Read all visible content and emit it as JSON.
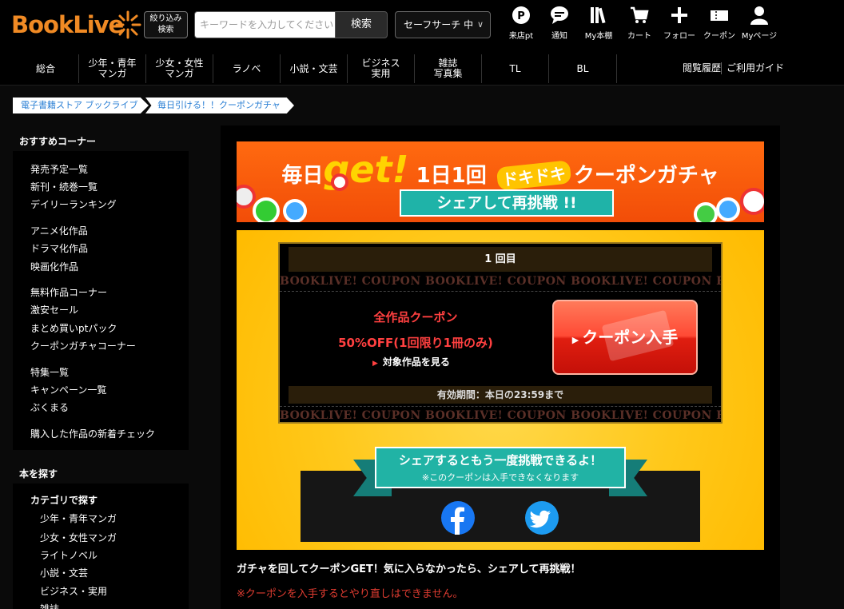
{
  "header": {
    "logo": "BookLive",
    "filter_label": "絞り込み\n検索",
    "search_placeholder": "キーワードを入力してください",
    "search_button": "検索",
    "safe_search": "セーフサーチ 中",
    "icons": [
      {
        "icon": "point-icon",
        "label": "来店pt"
      },
      {
        "icon": "bell-chat-icon",
        "label": "通知"
      },
      {
        "icon": "bookshelf-icon",
        "label": "My本棚"
      },
      {
        "icon": "cart-icon",
        "label": "カート"
      },
      {
        "icon": "plus-icon",
        "label": "フォロー"
      },
      {
        "icon": "coupon-icon",
        "label": "クーポン"
      },
      {
        "icon": "user-icon",
        "label": "Myページ"
      }
    ]
  },
  "nav": {
    "items": [
      "総合",
      "少年・青年\nマンガ",
      "少女・女性\nマンガ",
      "ラノベ",
      "小説・文芸",
      "ビジネス\n実用",
      "雑誌\n写真集",
      "TL",
      "BL"
    ],
    "history": "閲覧履歴",
    "guide": "ご利用ガイド"
  },
  "breadcrumb": [
    "電子書籍ストア ブックライブ",
    "毎日引ける！！クーポンガチャ"
  ],
  "sidebar": {
    "recommend_title": "おすすめコーナー",
    "group1": [
      "発売予定一覧",
      "新刊・続巻一覧",
      "デイリーランキング"
    ],
    "group2": [
      "アニメ化作品",
      "ドラマ化作品",
      "映画化作品"
    ],
    "group3": [
      "無料作品コーナー",
      "激安セール",
      "まとめ買いptパック",
      "クーポンガチャコーナー"
    ],
    "group4": [
      "特集一覧",
      "キャンペーン一覧",
      "ぶくまる"
    ],
    "group5": [
      "購入した作品の新着チェック"
    ],
    "find_title": "本を探す",
    "category_title": "カテゴリで探す",
    "categories": [
      "少年・青年マンガ",
      "少女・女性マンガ",
      "ライトノベル",
      "小説・文芸",
      "ビジネス・実用",
      "雑誌"
    ]
  },
  "banner": {
    "title_prefix": "毎日",
    "title_get": "get!",
    "title_once": "1日1回",
    "title_doki": "ドキドキ",
    "title_suffix": "クーポンガチャ",
    "ribbon": "シェアして再挑戦 !!"
  },
  "coupon": {
    "round": "1 回目",
    "stamp_text": "BOOKLIVE! COUPON BOOKLIVE! COUPON BOOKLIVE! COUPON BOOKLIVE! COUPON",
    "name": "全作品クーポン",
    "discount": "50%OFF(1回限り1冊のみ)",
    "target_link": "対象作品を見る",
    "get_button": "クーポン入手",
    "expiry": "有効期間：本日の23:59まで"
  },
  "share": {
    "title": "シェアするともう一度挑戦できるよ！",
    "note": "※このクーポンは入手できなくなります"
  },
  "description": "ガチャを回してクーポンGET！気に入らなかったら、シェアして再挑戦！",
  "warning": "※クーポンを入手するとやり直しはできません。",
  "colors": {
    "brand_orange": "#f08a24",
    "gacha_yellow": "#ffc81a",
    "teal": "#21b3a5",
    "coupon_red": "#ff4040"
  }
}
